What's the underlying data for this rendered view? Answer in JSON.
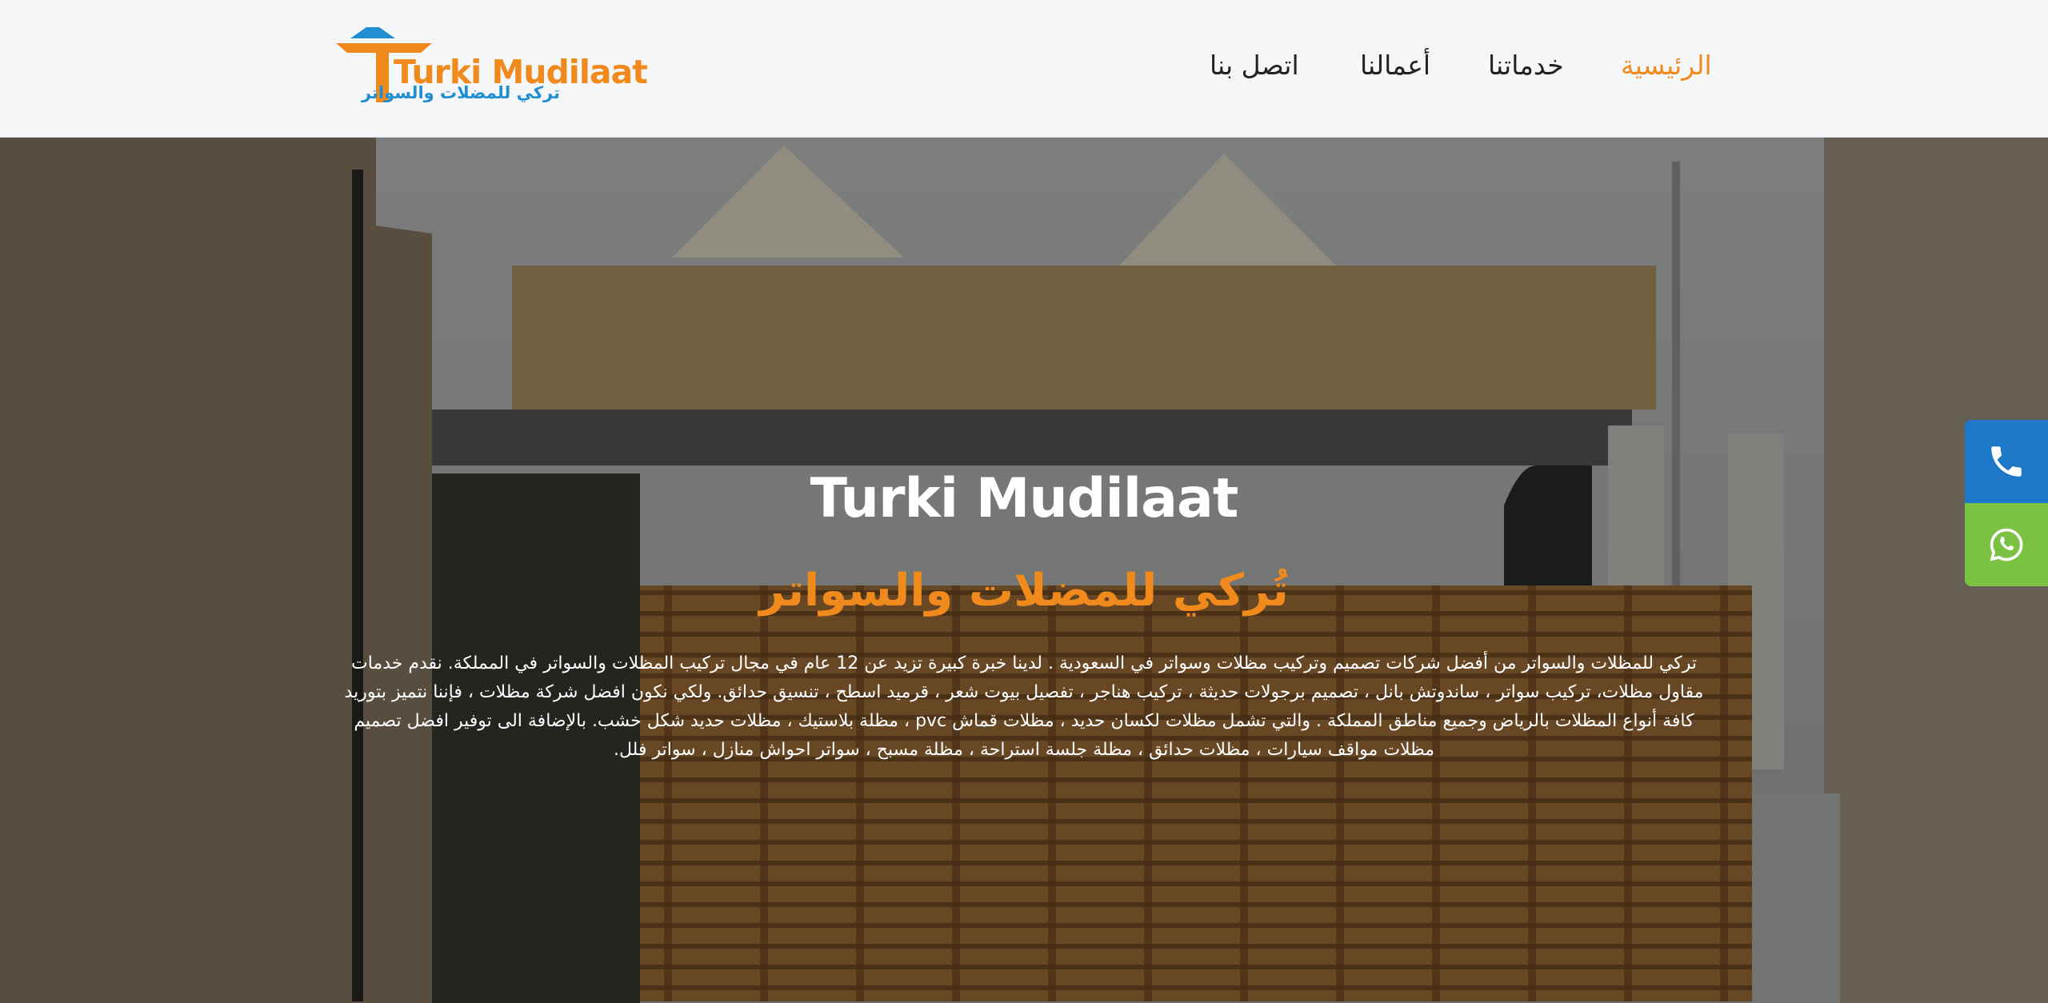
{
  "header": {
    "logo": {
      "text_en": "Turki Mudilaat",
      "text_ar": "تركي للمضلات والسواتر",
      "icon": "umbrella-logo-icon"
    },
    "nav": {
      "home": "الرئيسية",
      "services": "خدماتنا",
      "works": "أعمالنا",
      "contact": "اتصل بنا"
    }
  },
  "hero": {
    "title": "Turki Mudilaat",
    "subtitle": "تُركي للمضلات والسواتر",
    "description": "تركي للمظلات والسواتر من أفضل شركات تصميم وتركيب مظلات وسواتر في السعودية . لدينا خبرة كبيرة تزيد عن 12 عام في مجال تركيب المظلات والسواتر في المملكة. نقدم خدمات مقاول مظلات، تركيب سواتر ، ساندوتش بانل ، تصميم برجولات حديثة ، تركيب هناجر ، تفصيل بيوت شعر ، قرميد اسطح ، تنسيق حدائق. ولكي نكون افضل شركة مظلات ، فإننا نتميز بتوريد كافة أنواع المظلات بالرياض وجميع مناطق المملكة . والتي تشمل مظلات لكسان حديد ، مظلات قماش pvc ، مظلة بلاستيك ، مظلات حديد شكل خشب. بالإضافة الى توفير افضل تصميم مظلات مواقف سيارات ، مظلات حدائق ، مظلة جلسة استراحة ، مظلة مسبح ، سواتر احواش منازل ، سواتر فلل."
  },
  "floating": {
    "phone_icon": "phone-icon",
    "whatsapp_icon": "whatsapp-icon"
  },
  "colors": {
    "accent": "#f08a1c",
    "brand_blue": "#1f8fd1",
    "phone_bg": "#1e78c8",
    "whatsapp_bg": "#7cc242",
    "header_bg": "#f5f6f8"
  }
}
